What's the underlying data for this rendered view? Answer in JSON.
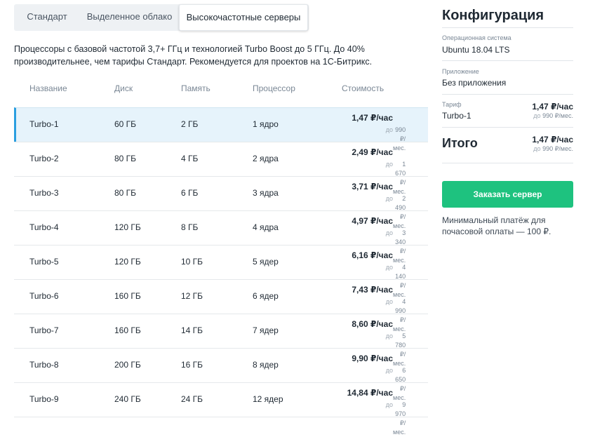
{
  "tabs": [
    {
      "label": "Стандарт",
      "active": false
    },
    {
      "label": "Выделенное облако",
      "active": false
    },
    {
      "label": "Высокочастотные серверы",
      "active": true
    }
  ],
  "description": "Процессоры с базовой частотой 3,7+ ГГц и технологией Turbo Boost до 5 ГГц. До 40% производительнее, чем тарифы Стандарт. Рекомендуется для проектов на 1С-Битрикс.",
  "table": {
    "headers": {
      "name": "Название",
      "disk": "Диск",
      "memory": "Память",
      "cpu": "Процессор",
      "price": "Стоимость"
    },
    "rows": [
      {
        "name": "Turbo-1",
        "disk": "60 ГБ",
        "memory": "2 ГБ",
        "cpu": "1 ядро",
        "price": "1,47 ₽/час",
        "price_prefix": "до",
        "monthly": "990 ₽/мес."
      },
      {
        "name": "Turbo-2",
        "disk": "80 ГБ",
        "memory": "4 ГБ",
        "cpu": "2 ядра",
        "price": "2,49 ₽/час",
        "price_prefix": "до",
        "monthly": "1 670 ₽/мес."
      },
      {
        "name": "Turbo-3",
        "disk": "80 ГБ",
        "memory": "6 ГБ",
        "cpu": "3 ядра",
        "price": "3,71 ₽/час",
        "price_prefix": "до",
        "monthly": "2 490 ₽/мес."
      },
      {
        "name": "Turbo-4",
        "disk": "120 ГБ",
        "memory": "8 ГБ",
        "cpu": "4 ядра",
        "price": "4,97 ₽/час",
        "price_prefix": "до",
        "monthly": "3 340 ₽/мес."
      },
      {
        "name": "Turbo-5",
        "disk": "120 ГБ",
        "memory": "10 ГБ",
        "cpu": "5 ядер",
        "price": "6,16 ₽/час",
        "price_prefix": "до",
        "monthly": "4 140 ₽/мес."
      },
      {
        "name": "Turbo-6",
        "disk": "160 ГБ",
        "memory": "12 ГБ",
        "cpu": "6 ядер",
        "price": "7,43 ₽/час",
        "price_prefix": "до",
        "monthly": "4 990 ₽/мес."
      },
      {
        "name": "Turbo-7",
        "disk": "160 ГБ",
        "memory": "14 ГБ",
        "cpu": "7 ядер",
        "price": "8,60 ₽/час",
        "price_prefix": "до",
        "monthly": "5 780 ₽/мес."
      },
      {
        "name": "Turbo-8",
        "disk": "200 ГБ",
        "memory": "16 ГБ",
        "cpu": "8 ядер",
        "price": "9,90 ₽/час",
        "price_prefix": "до",
        "monthly": "6 650 ₽/мес."
      },
      {
        "name": "Turbo-9",
        "disk": "240 ГБ",
        "memory": "24 ГБ",
        "cpu": "12 ядер",
        "price": "14,84 ₽/час",
        "price_prefix": "до",
        "monthly": "9 970 ₽/мес."
      }
    ],
    "selected_index": 0
  },
  "config": {
    "title": "Конфигурация",
    "os_label": "Операционная система",
    "os_value": "Ubuntu 18.04 LTS",
    "app_label": "Приложение",
    "app_value": "Без приложения",
    "tariff_label": "Тариф",
    "tariff_value": "Turbo-1",
    "tariff_price": "1,47 ₽/час",
    "tariff_prefix": "до",
    "tariff_monthly": "990 ₽/мес.",
    "total_label": "Итого",
    "total_price": "1,47 ₽/час",
    "total_prefix": "до",
    "total_monthly": "990 ₽/мес.",
    "order_button": "Заказать сервер",
    "note": "Минимальный платёж для почасовой оплаты — 100 ₽."
  },
  "colors": {
    "accent": "#2b9fe0",
    "selected_row_bg": "#e6f3fb",
    "order_button": "#1ec27f",
    "muted_text": "#7a8795"
  }
}
